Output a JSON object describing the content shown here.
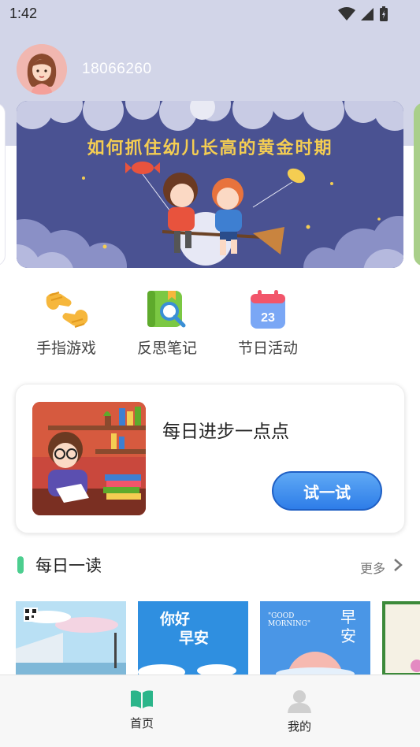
{
  "status_bar": {
    "time": "1:42",
    "icons": [
      "wifi-icon",
      "signal-icon",
      "battery-icon"
    ]
  },
  "user": {
    "id": "18066260"
  },
  "banner": {
    "title": "如何抓住幼儿长高的黄金时期"
  },
  "quick_actions": [
    {
      "label": "手指游戏",
      "icon": "finger-game-icon"
    },
    {
      "label": "反思笔记",
      "icon": "notebook-search-icon"
    },
    {
      "label": "节日活动",
      "icon": "calendar-icon",
      "calendar_day": "23"
    }
  ],
  "promo": {
    "title": "每日进步一点点",
    "button_label": "试一试"
  },
  "daily_read": {
    "title": "每日一读",
    "more_label": "更多",
    "cards": [
      {
        "lines": []
      },
      {
        "lines": [
          "你好",
          "早安"
        ]
      },
      {
        "lines": [
          "\"GOOD",
          "MORNING\"",
          "早",
          "安"
        ]
      },
      {
        "lines": []
      }
    ]
  },
  "bottom_nav": [
    {
      "label": "首页",
      "icon": "book-icon",
      "active": true
    },
    {
      "label": "我的",
      "icon": "user-icon",
      "active": false
    }
  ],
  "colors": {
    "accent": "#4cce8f",
    "button_blue": "#2e7de8",
    "banner_bg": "#4a5292",
    "header_bg": "#d2d5e8"
  }
}
